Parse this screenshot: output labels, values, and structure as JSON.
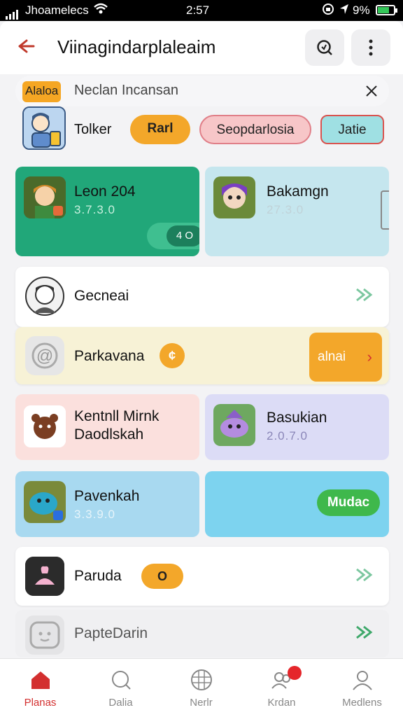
{
  "status_bar": {
    "carrier": "Jhoamelecs",
    "time": "2:57",
    "battery": "9%"
  },
  "header": {
    "title": "Viinagindarplaleaim"
  },
  "search": {
    "tag": "Alaloa",
    "text": "Neclan Incansan"
  },
  "filters": {
    "label": "Tolker",
    "pills": [
      "Rarl",
      "Seopdarlosia",
      "Jatie"
    ]
  },
  "cards": {
    "leon": {
      "name": "Leon 204",
      "sub": "3.7.3.0",
      "toggle": "4 O"
    },
    "bakamgn": {
      "name": "Bakamgn",
      "sub": "27.3.0"
    },
    "gecneai": {
      "name": "Gecneai"
    },
    "parkavana": {
      "name": "Parkavana",
      "coin": "¢",
      "button": "alnai"
    },
    "kentnll": {
      "name_line1": "Kentnll Mirnk",
      "name_line2": "Daodlskah"
    },
    "basukian": {
      "name": "Basukian",
      "sub": "2.0.7.0"
    },
    "pavenkah": {
      "name": "Pavenkah",
      "sub": "3.3.9.0"
    },
    "mudac": {
      "button": "Mudac"
    },
    "paruda": {
      "name": "Paruda",
      "coin": "O"
    },
    "paptedarin": {
      "name": "PapteDarin"
    }
  },
  "bottom_nav": {
    "items": [
      "Planas",
      "Dalia",
      "Nerlr",
      "Krdan",
      "Medlens"
    ]
  },
  "colors": {
    "accent": "#d32f2f",
    "green": "#21a779",
    "orange": "#f3a72a",
    "link_green": "#3ea86a"
  }
}
